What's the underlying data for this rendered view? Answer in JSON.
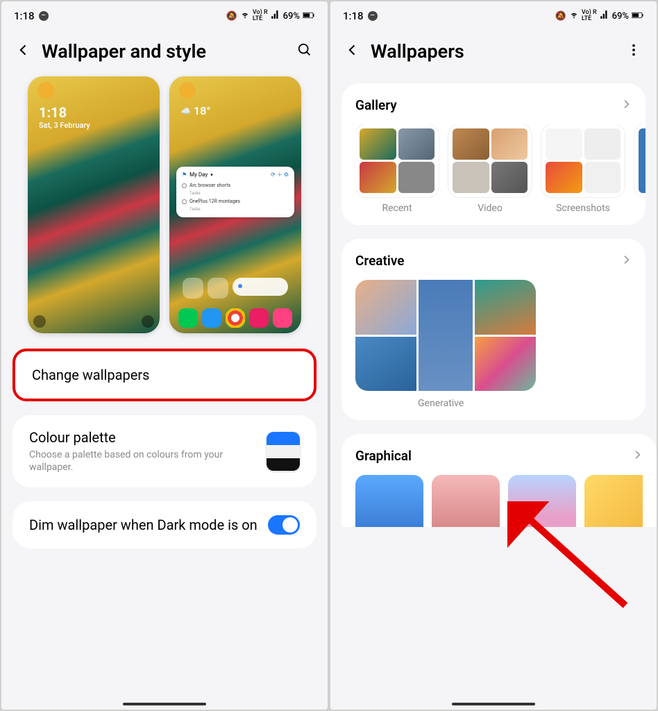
{
  "status": {
    "time": "1:18",
    "network_label": "Vo) R",
    "lte_label": "LTE",
    "battery": "69%"
  },
  "left": {
    "title": "Wallpaper and style",
    "lock_time": "1:18",
    "lock_date": "Sat, 3 February",
    "weather_temp": "18°",
    "widget_title": "My Day",
    "task1": "Arc browser shorts",
    "task1_sub": "Tasks",
    "task2": "OnePlus 12R montages",
    "task2_sub": "Tasks",
    "change_wallpapers": "Change wallpapers",
    "colour_palette_title": "Colour palette",
    "colour_palette_sub": "Choose a palette based on colours from your wallpaper.",
    "dim_title": "Dim wallpaper when Dark mode is on",
    "palette_colors": [
      "#1976ff",
      "#f2f2f2",
      "#111111"
    ]
  },
  "right": {
    "title": "Wallpapers",
    "gallery_title": "Gallery",
    "gallery_items": [
      "Recent",
      "Video",
      "Screenshots"
    ],
    "creative_title": "Creative",
    "creative_item": "Generative",
    "graphical_title": "Graphical"
  }
}
